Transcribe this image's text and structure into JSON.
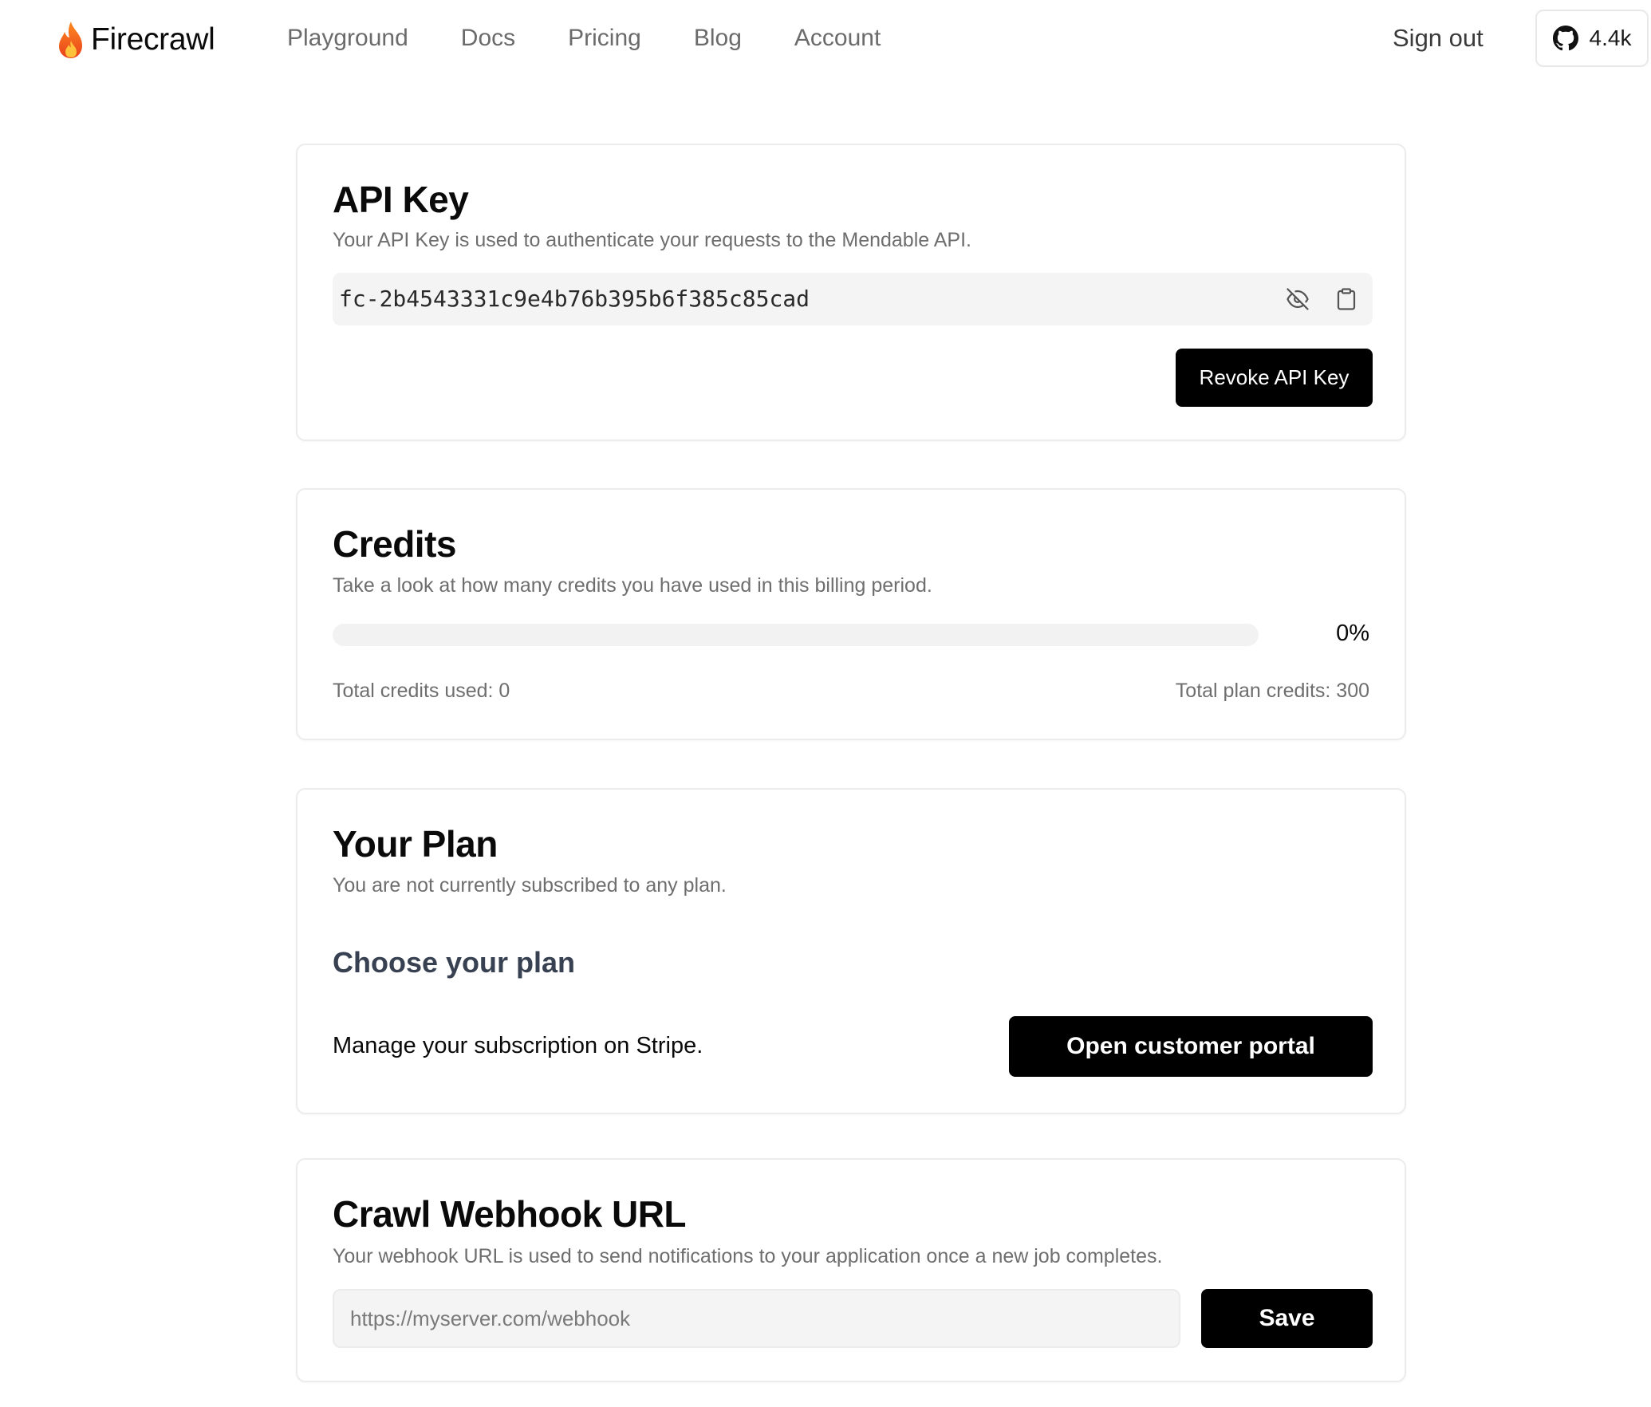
{
  "header": {
    "brand": "Firecrawl",
    "nav": [
      {
        "label": "Playground"
      },
      {
        "label": "Docs"
      },
      {
        "label": "Pricing"
      },
      {
        "label": "Blog"
      },
      {
        "label": "Account"
      }
    ],
    "sign_out": "Sign out",
    "github": {
      "icon": "github-icon",
      "count": "4.4k"
    }
  },
  "api_key": {
    "title": "API Key",
    "description": "Your API Key is used to authenticate your requests to the Mendable API.",
    "key_value": "fc-2b4543331c9e4b76b395b6f385c85cad",
    "hide_icon": "eye-off-icon",
    "copy_icon": "clipboard-icon",
    "revoke_label": "Revoke API Key"
  },
  "credits": {
    "title": "Credits",
    "description": "Take a look at how many credits you have used in this billing period.",
    "usage_fraction": 0,
    "percent_label": "0%",
    "total_used": "Total credits used: 0",
    "total_plan": "Total plan credits: 300"
  },
  "plan": {
    "title": "Your Plan",
    "description": "You are not currently subscribed to any plan.",
    "choose_heading": "Choose your plan",
    "manage_text": "Manage your subscription on Stripe.",
    "portal_label": "Open customer portal"
  },
  "webhook": {
    "title": "Crawl Webhook URL",
    "description": "Your webhook URL is used to send notifications to your application once a new job completes.",
    "placeholder": "https://myserver.com/webhook",
    "value": "",
    "save_label": "Save"
  },
  "colors": {
    "primary_button": "#000000",
    "muted_text": "#6e6e6e",
    "field_bg": "#f4f4f4",
    "card_border": "#ececec"
  }
}
